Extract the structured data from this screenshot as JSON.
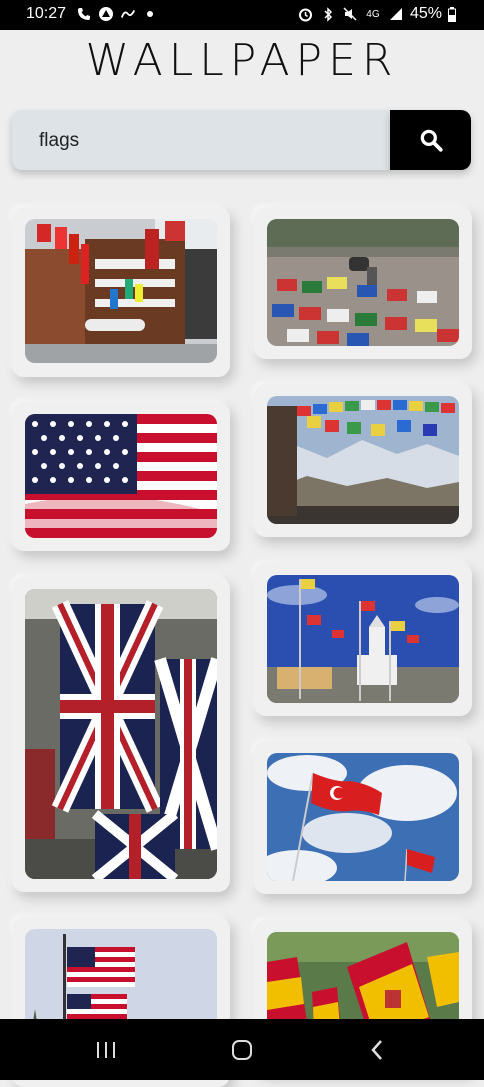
{
  "status_bar": {
    "time": "10:27",
    "network": "4G",
    "battery": "45%"
  },
  "app": {
    "title": "WALLPAPER"
  },
  "search": {
    "value": "flags",
    "button_icon": "search-icon"
  },
  "wallpapers": [
    {
      "name": "wallpaper-mountain-hotel-flags"
    },
    {
      "name": "wallpaper-flags-on-pavement"
    },
    {
      "name": "wallpaper-usa-flag"
    },
    {
      "name": "wallpaper-prayer-flags-mountains"
    },
    {
      "name": "wallpaper-union-jack-flags"
    },
    {
      "name": "wallpaper-flags-town-hall"
    },
    {
      "name": "wallpaper-turkish-flags-sky"
    },
    {
      "name": "wallpaper-usa-flag-pole"
    },
    {
      "name": "wallpaper-spanish-flags-crowd"
    }
  ],
  "nav": {
    "recents": "recents-icon",
    "home": "home-icon",
    "back": "back-icon"
  }
}
